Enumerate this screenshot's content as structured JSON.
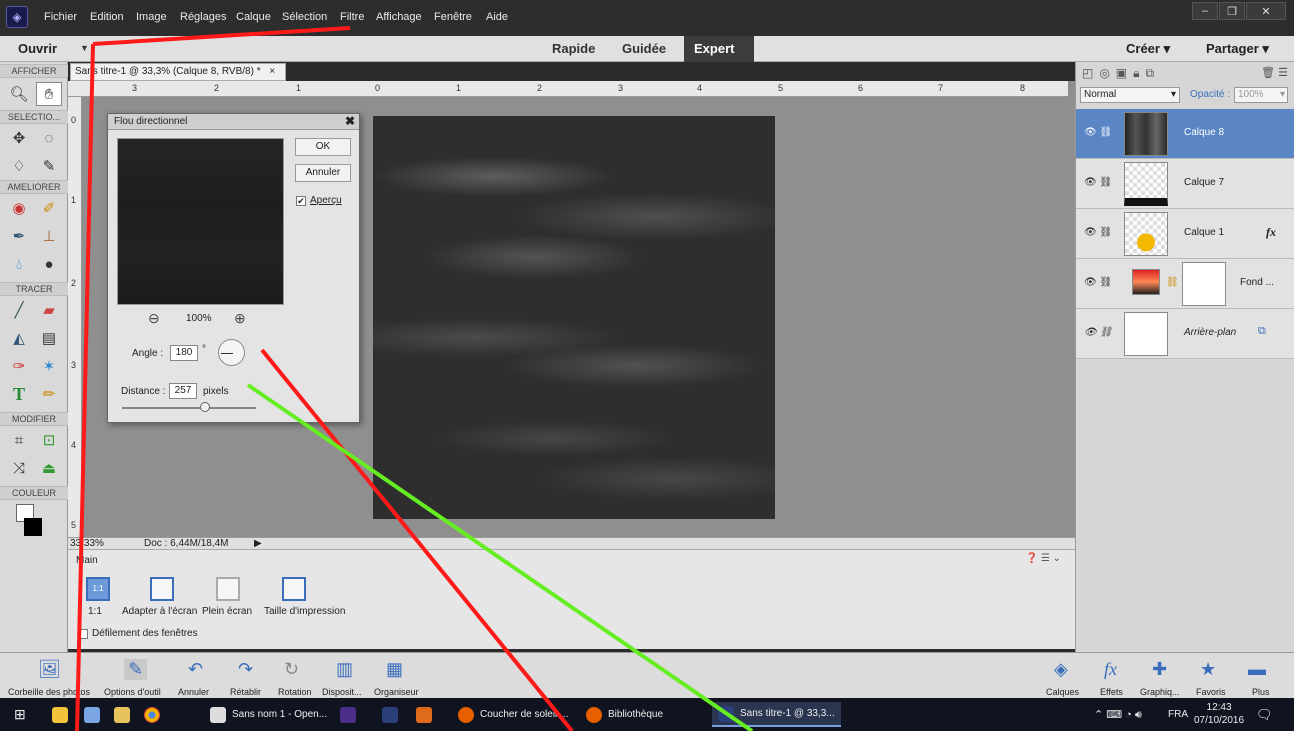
{
  "menu": {
    "items": [
      "Fichier",
      "Edition",
      "Image",
      "Réglages",
      "Calque",
      "Sélection",
      "Filtre",
      "Affichage",
      "Fenêtre",
      "Aide"
    ]
  },
  "modebar": {
    "open_label": "Ouvrir",
    "modes": [
      "Rapide",
      "Guidée",
      "Expert"
    ],
    "active_mode": "Expert",
    "create_label": "Créer",
    "share_label": "Partager"
  },
  "toolbox": {
    "sections": [
      "AFFICHER",
      "SELECTIO...",
      "AMELIORER",
      "TRACER",
      "MODIFIER",
      "COULEUR"
    ]
  },
  "document": {
    "tab_title": "Sans titre-1 @ 33,3% (Calque 8, RVB/8) *",
    "tab_close": "×",
    "ruler_h": [
      "3",
      "2",
      "1",
      "0",
      "1",
      "2",
      "3",
      "4",
      "5",
      "6",
      "7",
      "8"
    ],
    "ruler_v": [
      "0",
      "1",
      "2",
      "3",
      "4",
      "5"
    ],
    "zoom_status": "33,33%",
    "doc_status": "Doc : 6,44M/18,4M"
  },
  "dialog": {
    "title": "Flou directionnel",
    "close": "✖",
    "ok_label": "OK",
    "cancel_label": "Annuler",
    "preview_label": "Aperçu",
    "preview_checked": true,
    "zoom_value": "100%",
    "angle_label": "Angle :",
    "angle_value": "180",
    "angle_unit": "°",
    "distance_label": "Distance :",
    "distance_value": "257",
    "distance_unit": "pixels",
    "distance_slider_fraction": 0.62
  },
  "options": {
    "tool_name": "Main",
    "buttons": [
      "1:1",
      "Adapter à l'écran",
      "Plein écran",
      "Taille d'impression"
    ],
    "scroll_label": "Défilement des fenêtres"
  },
  "layers": {
    "blend_mode": "Normal",
    "opacity_label": "Opacité :",
    "opacity_value": "100%",
    "items": [
      {
        "name": "Calque 8",
        "selected": true
      },
      {
        "name": "Calque 7",
        "selected": false
      },
      {
        "name": "Calque 1",
        "selected": false,
        "fx": "fx"
      },
      {
        "name": "Fond ...",
        "selected": false
      },
      {
        "name": "Arrière-plan",
        "selected": false
      }
    ]
  },
  "bottom_bar": {
    "left_items": [
      "Corbeille des photos",
      "Options d'outil",
      "Annuler",
      "Rétablir",
      "Rotation",
      "Disposit...",
      "Organiseur"
    ],
    "right_items": [
      "Calques",
      "Effets",
      "Graphiq...",
      "Favoris",
      "Plus"
    ]
  },
  "taskbar": {
    "apps": [
      "Sans nom 1 - Open...",
      "Coucher de soleil ...",
      "Bibliothèque",
      "Sans titre-1 @ 33,3..."
    ],
    "lang": "FRA",
    "time": "12:43",
    "date": "07/10/2016"
  },
  "colors": {
    "accent": "#3a6ebd",
    "annotation_red": "#ff1a1a",
    "annotation_green": "#66ee22"
  }
}
